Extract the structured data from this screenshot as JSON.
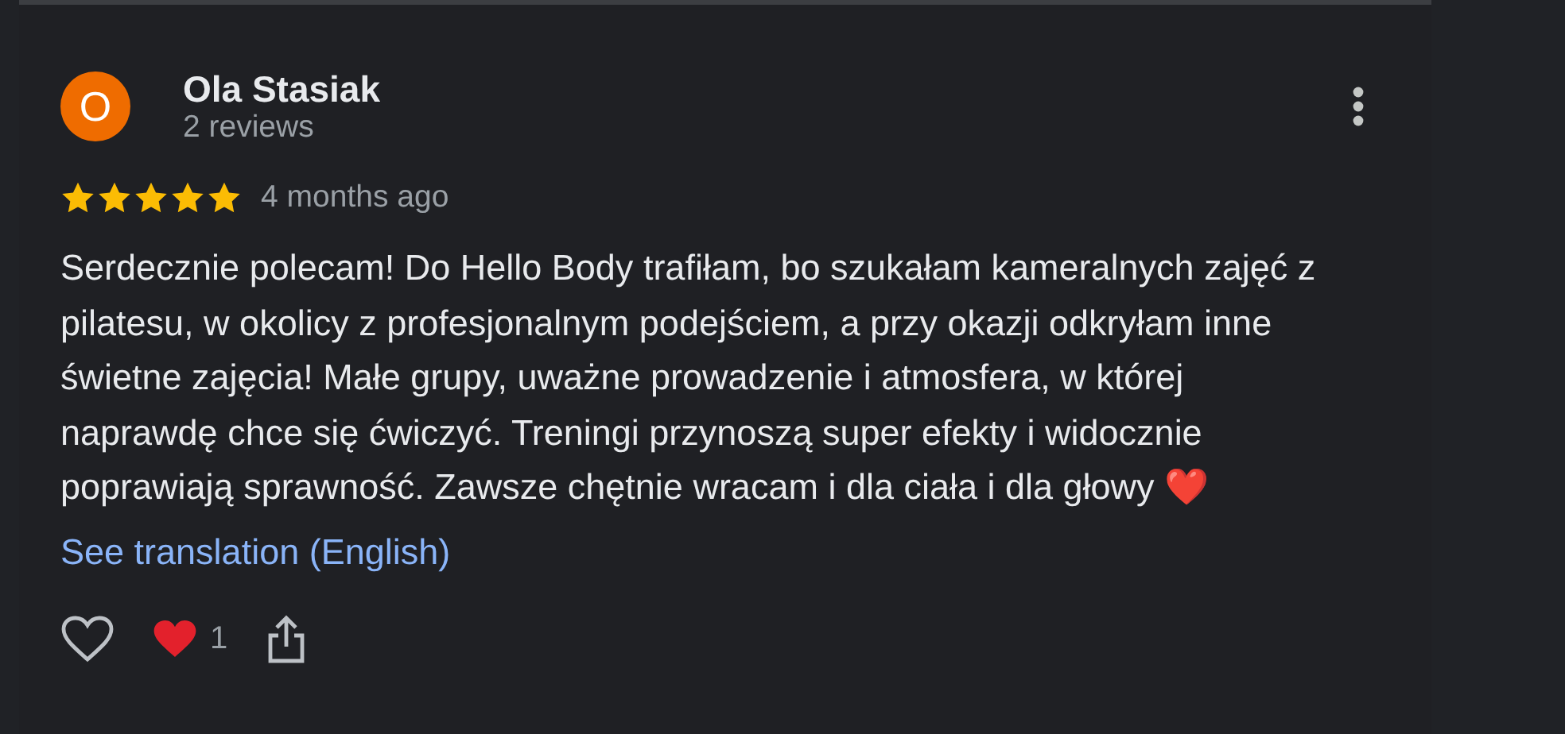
{
  "review": {
    "avatar_letter": "O",
    "author": "Ola Stasiak",
    "meta": "2 reviews",
    "stars": 5,
    "time": "4 months ago",
    "text": "Serdecznie polecam! Do Hello Body trafiłam, bo szukałam kameralnych zajęć z pilatesu, w okolicy z profesjonalnym podejściem, a przy okazji odkryłam inne świetne zajęcia! Małe grupy, uważne prowadzenie i atmosfera, w której naprawdę chce się ćwiczyć. Treningi przynoszą super efekty i widocznie poprawiają sprawność. Zawsze chętnie wracam i dla ciała i dla głowy ❤️",
    "translate_link": "See translation (English)",
    "reactions": {
      "liked": false,
      "heart_count": "1"
    }
  }
}
